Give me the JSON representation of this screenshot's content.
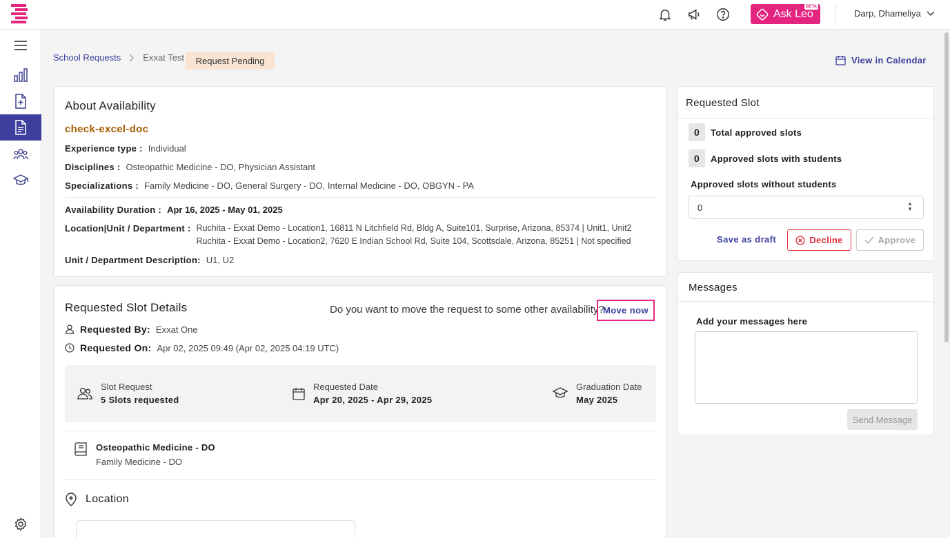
{
  "header": {
    "ask_leo_label": "Ask Leo",
    "ask_leo_badge": "BETA",
    "user_name": "Darp, Dhameliya"
  },
  "sidebar": {
    "items": [
      "menu-icon",
      "analytics-icon",
      "add-document-icon",
      "document-icon",
      "users-group-icon",
      "graduation-cap-icon",
      "settings-icon"
    ],
    "active_index": 3
  },
  "breadcrumb": {
    "root": "School Requests",
    "current": "Exxat Test",
    "status": "Request Pending"
  },
  "view_calendar_label": "View in Calendar",
  "about": {
    "title": "About Availability",
    "name": "check-excel-doc",
    "experience_type_label": "Experience type :",
    "experience_type": "Individual",
    "disciplines_label": "Disciplines :",
    "disciplines": "Osteopathic Medicine - DO, Physician Assistant",
    "specializations_label": "Specializations :",
    "specializations": "Family Medicine - DO, General Surgery - DO, Internal Medicine - DO, OBGYN - PA",
    "duration_label": "Availability Duration :",
    "duration": "Apr 16, 2025 - May 01, 2025",
    "location_label": "Location|Unit / Department :",
    "locations": [
      "Ruchita - Exxat Demo - Location1, 16811 N Litchfield Rd, Bldg A, Suite101, Surprise, Arizona, 85374 | Unit1, Unit2",
      "Ruchita - Exxat Demo - Location2, 7620 E Indian School Rd, Suite 104, Scottsdale, Arizona, 85251 | Not specified"
    ],
    "unit_desc_label": "Unit / Department Description:",
    "unit_desc": "U1, U2"
  },
  "slot_details": {
    "title": "Requested Slot Details",
    "move_question": "Do you want to move the request to some other availability?",
    "move_button": "Move now",
    "requested_by_label": "Requested By:",
    "requested_by": "Exxat One",
    "requested_on_label": "Requested On:",
    "requested_on": "Apr 02, 2025 09:49 (Apr 02, 2025 04:19 UTC)",
    "slot_request_label": "Slot Request",
    "slot_request_value": "5 Slots requested",
    "requested_date_label": "Requested Date",
    "requested_date_value": "Apr 20, 2025 - Apr 29, 2025",
    "graduation_label": "Graduation Date",
    "graduation_value": "May 2025",
    "discipline_title": "Osteopathic Medicine - DO",
    "discipline_sub": "Family Medicine - DO",
    "location_title": "Location"
  },
  "requested_slot": {
    "title": "Requested Slot",
    "total_approved_label": "Total approved slots",
    "total_approved": "0",
    "approved_with_students_label": "Approved slots with students",
    "approved_with_students": "0",
    "without_students_label": "Approved slots without students",
    "without_students_value": "0",
    "save_draft": "Save as draft",
    "decline": "Decline",
    "approve": "Approve"
  },
  "messages": {
    "title": "Messages",
    "add_label": "Add your messages here",
    "send": "Send Message"
  },
  "colors": {
    "primary": "#3d3f9e",
    "brand": "#e4257f",
    "decline": "#e0303a",
    "status_pill": "#f9e4d3",
    "doc_name": "#a65c00"
  }
}
